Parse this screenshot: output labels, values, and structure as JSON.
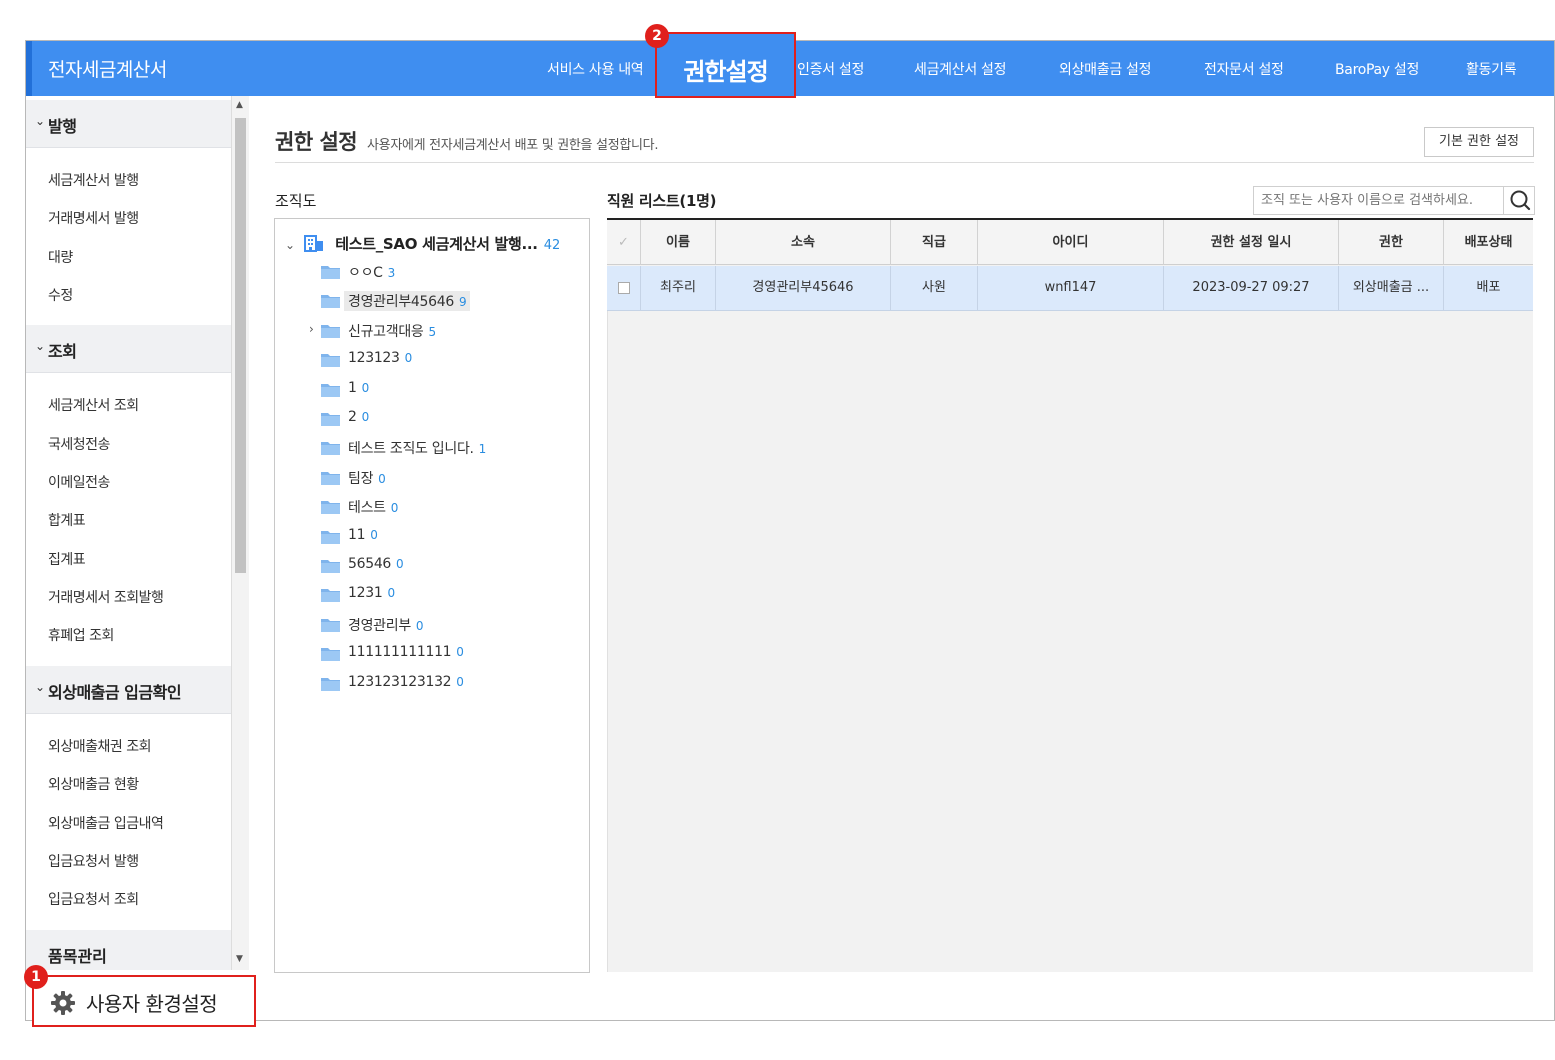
{
  "app_title": "전자세금계산서",
  "top_nav": [
    {
      "label": "서비스 사용 내역"
    },
    {
      "label": "권한설정"
    },
    {
      "label": "인증서 설정"
    },
    {
      "label": "세금계산서 설정"
    },
    {
      "label": "외상매출금 설정"
    },
    {
      "label": "전자문서 설정"
    },
    {
      "label": "BaroPay 설정"
    },
    {
      "label": "활동기록"
    }
  ],
  "sidebar": {
    "sections": [
      {
        "title": "발행",
        "items": [
          "세금계산서 발행",
          "거래명세서 발행",
          "대량",
          "수정"
        ]
      },
      {
        "title": "조회",
        "items": [
          "세금계산서 조회",
          "국세청전송",
          "이메일전송",
          "합계표",
          "집계표",
          "거래명세서 조회발행",
          "휴폐업 조회"
        ]
      },
      {
        "title": "외상매출금 입금확인",
        "items": [
          "외상매출채권 조회",
          "외상매출금 현황",
          "외상매출금 입금내역",
          "입금요청서 발행",
          "입금요청서 조회"
        ]
      },
      {
        "title": "품목관리",
        "items": []
      }
    ],
    "user_settings_label": "사용자 환경설정"
  },
  "page": {
    "title": "권한 설정",
    "description": "사용자에게 전자세금계산서 배포 및 권한을 설정합니다.",
    "default_button": "기본 권한 설정"
  },
  "org": {
    "label": "조직도",
    "root": {
      "name": "테스트_SAO 세금계산서 발행...",
      "count": "42"
    },
    "items": [
      {
        "name": "ㅇㅇC",
        "count": "3"
      },
      {
        "name": "경영관리부45646",
        "count": "9"
      },
      {
        "name": "신규고객대응",
        "count": "5"
      },
      {
        "name": "123123",
        "count": "0"
      },
      {
        "name": "1",
        "count": "0"
      },
      {
        "name": "2",
        "count": "0"
      },
      {
        "name": "테스트 조직도 입니다.",
        "count": "1"
      },
      {
        "name": "팀장",
        "count": "0"
      },
      {
        "name": "테스트",
        "count": "0"
      },
      {
        "name": "11",
        "count": "0"
      },
      {
        "name": "56546",
        "count": "0"
      },
      {
        "name": "1231",
        "count": "0"
      },
      {
        "name": "경영관리부",
        "count": "0"
      },
      {
        "name": "111111111111",
        "count": "0"
      },
      {
        "name": "123123123132",
        "count": "0"
      }
    ]
  },
  "employees": {
    "label": "직원 리스트(1명)",
    "search_placeholder": "조직 또는 사용자 이름으로 검색하세요.",
    "columns": [
      "이름",
      "소속",
      "직급",
      "아이디",
      "권한 설정 일시",
      "권한",
      "배포상태"
    ],
    "rows": [
      {
        "name": "최주리",
        "dept": "경영관리부45646",
        "rank": "사원",
        "id": "wnfl147",
        "date": "2023-09-27 09:27",
        "perm": "외상매출금 ...",
        "status": "배포"
      }
    ]
  },
  "callouts": {
    "one": "1",
    "two": "2"
  },
  "colors": {
    "topbar": "#3f8ef0",
    "highlight": "#e0201c",
    "count": "#2a8de0",
    "selected_row": "#dbe9fb"
  }
}
